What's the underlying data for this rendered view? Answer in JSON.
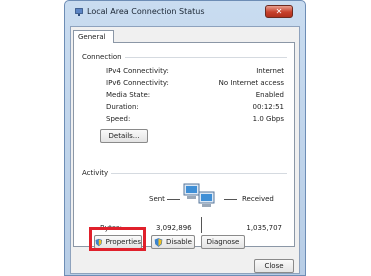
{
  "window": {
    "title": "Local Area Connection Status",
    "close_glyph": "✕"
  },
  "tabs": [
    {
      "label": "General"
    }
  ],
  "connection": {
    "group_label": "Connection",
    "rows": [
      {
        "label": "IPv4 Connectivity:",
        "value": "Internet"
      },
      {
        "label": "IPv6 Connectivity:",
        "value": "No Internet access"
      },
      {
        "label": "Media State:",
        "value": "Enabled"
      },
      {
        "label": "Duration:",
        "value": "00:12:51"
      },
      {
        "label": "Speed:",
        "value": "1.0 Gbps"
      }
    ],
    "details_label": "Details..."
  },
  "activity": {
    "group_label": "Activity",
    "sent_label": "Sent",
    "received_label": "Received",
    "bytes_label": "Bytes:",
    "bytes_sent": "3,092,896",
    "bytes_received": "1,035,707"
  },
  "actions": {
    "properties_label": "Properties",
    "disable_label": "Disable",
    "diagnose_label": "Diagnose"
  },
  "footer": {
    "close_label": "Close"
  },
  "colors": {
    "highlight": "#e0202b",
    "title_bg": "#c9dcf0"
  }
}
